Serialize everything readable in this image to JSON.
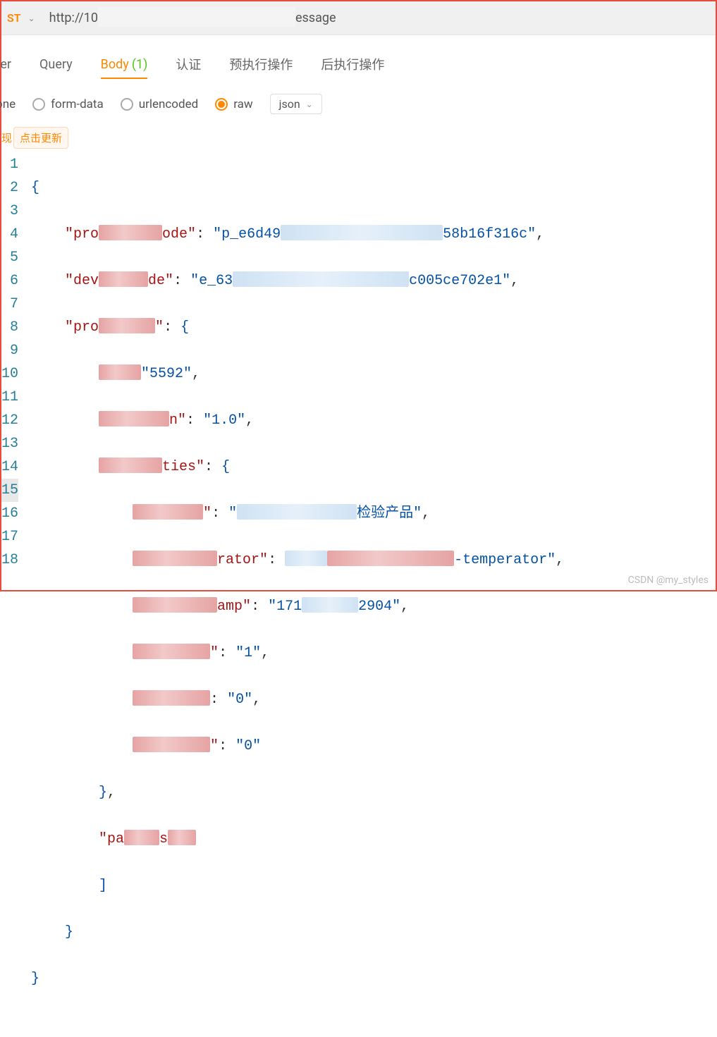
{
  "url_bar": {
    "method": "ST",
    "url_visible_prefix": "http://10",
    "url_visible_suffix": "essage"
  },
  "tabs": [
    {
      "key": "header",
      "label": "ler"
    },
    {
      "key": "query",
      "label": "Query"
    },
    {
      "key": "body",
      "label": "Body",
      "count": "(1)",
      "active": true
    },
    {
      "key": "auth",
      "label": "认证"
    },
    {
      "key": "pre",
      "label": "预执行操作"
    },
    {
      "key": "post",
      "label": "后执行操作"
    }
  ],
  "body_types": [
    {
      "key": "none",
      "label": "one",
      "selected": false
    },
    {
      "key": "form-data",
      "label": "form-data",
      "selected": false
    },
    {
      "key": "urlencoded",
      "label": "urlencoded",
      "selected": false
    },
    {
      "key": "raw",
      "label": "raw",
      "selected": true
    }
  ],
  "raw_format": {
    "label": "json"
  },
  "notice": {
    "prefix": "现",
    "action": "点击更新"
  },
  "watermark": "CSDN @my_styles",
  "code": {
    "line_count": 18,
    "lines": {
      "1": {
        "open_brace": "{"
      },
      "2": {
        "key_pre": "\"pro",
        "key_post": "ode\"",
        "colon": ": ",
        "val_pre": "\"p_e6d49",
        "val_post": "58b16f316c\"",
        "comma": ","
      },
      "3": {
        "key_pre": "\"dev",
        "key_post": "de\"",
        "colon": ": ",
        "val_pre": "\"e_63",
        "val_post": "c005ce702e1\"",
        "comma": ","
      },
      "4": {
        "key_pre": "\"pro",
        "key_post": "\"",
        "colon": ": ",
        "brace": "{"
      },
      "5": {
        "val_pre": "\"5592\"",
        "comma": ","
      },
      "6": {
        "key_post": "n\"",
        "colon": ": ",
        "val": "\"1.0\"",
        "comma": ","
      },
      "7": {
        "key_post": "ties\"",
        "colon": ": ",
        "brace": "{"
      },
      "8": {
        "key_post": "\"",
        "colon": ": ",
        "val_pre": "\"",
        "val_post": "检验产品\"",
        "comma": ","
      },
      "9": {
        "key_post": "rator\"",
        "colon": ": ",
        "val_post": "-temperator\"",
        "comma": ","
      },
      "10": {
        "key_post": "amp\"",
        "colon": ": ",
        "val_pre": "\"171",
        "val_post": "2904\"",
        "comma": ","
      },
      "11": {
        "key_post": "\"",
        "colon": ": ",
        "val": "\"1\"",
        "comma": ","
      },
      "12": {
        "colon": ": ",
        "val": "\"0\"",
        "comma": ","
      },
      "13": {
        "key_post": "\"",
        "colon": ": ",
        "val": "\"0\""
      },
      "14": {
        "close_brace": "}",
        "comma": ","
      },
      "15": {
        "key_pre": "\"pa",
        "key_post": "s"
      },
      "16": {
        "close_bracket": "]"
      },
      "17": {
        "close_brace": "}"
      },
      "18": {
        "close_brace": "}"
      }
    }
  }
}
